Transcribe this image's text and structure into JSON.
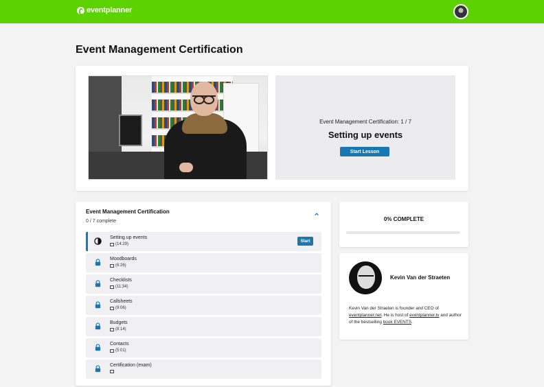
{
  "header": {
    "logo_text": "eventplanner",
    "brand_color": "#5cd200"
  },
  "page": {
    "title": "Event Management Certification"
  },
  "hero": {
    "counter": "Event Management Certification: 1 / 7",
    "lesson_title": "Setting up events",
    "start_label": "Start Lesson"
  },
  "course": {
    "heading": "Event Management Certification",
    "complete_count": "0 / 7 complete",
    "lessons": [
      {
        "name": "Setting up events",
        "duration": "(14:29)",
        "status": "in-progress",
        "action": "Start"
      },
      {
        "name": "Moodboards",
        "duration": "(6:26)",
        "status": "locked"
      },
      {
        "name": "Checklists",
        "duration": "(11:34)",
        "status": "locked"
      },
      {
        "name": "Callsheets",
        "duration": "(9:06)",
        "status": "locked"
      },
      {
        "name": "Budgets",
        "duration": "(8:14)",
        "status": "locked"
      },
      {
        "name": "Contacts",
        "duration": "(5:01)",
        "status": "locked"
      },
      {
        "name": "Certification (exam)",
        "duration": "",
        "status": "locked"
      }
    ]
  },
  "progress": {
    "label": "0% COMPLETE",
    "fraction": 0
  },
  "author": {
    "name": "Kevin Van der Straeten",
    "bio_1": "Kevin Van der Straeten is founder and CEO of ",
    "link_1": "eventplanner.net",
    "bio_2": ". He is host of ",
    "link_2": "eventplanner.tv",
    "bio_3": " and author of the bestselling ",
    "link_3": "book EVENTS",
    "bio_4": "."
  },
  "colors": {
    "accent": "#1778b3",
    "lesson_bg": "#f0f0f2"
  }
}
